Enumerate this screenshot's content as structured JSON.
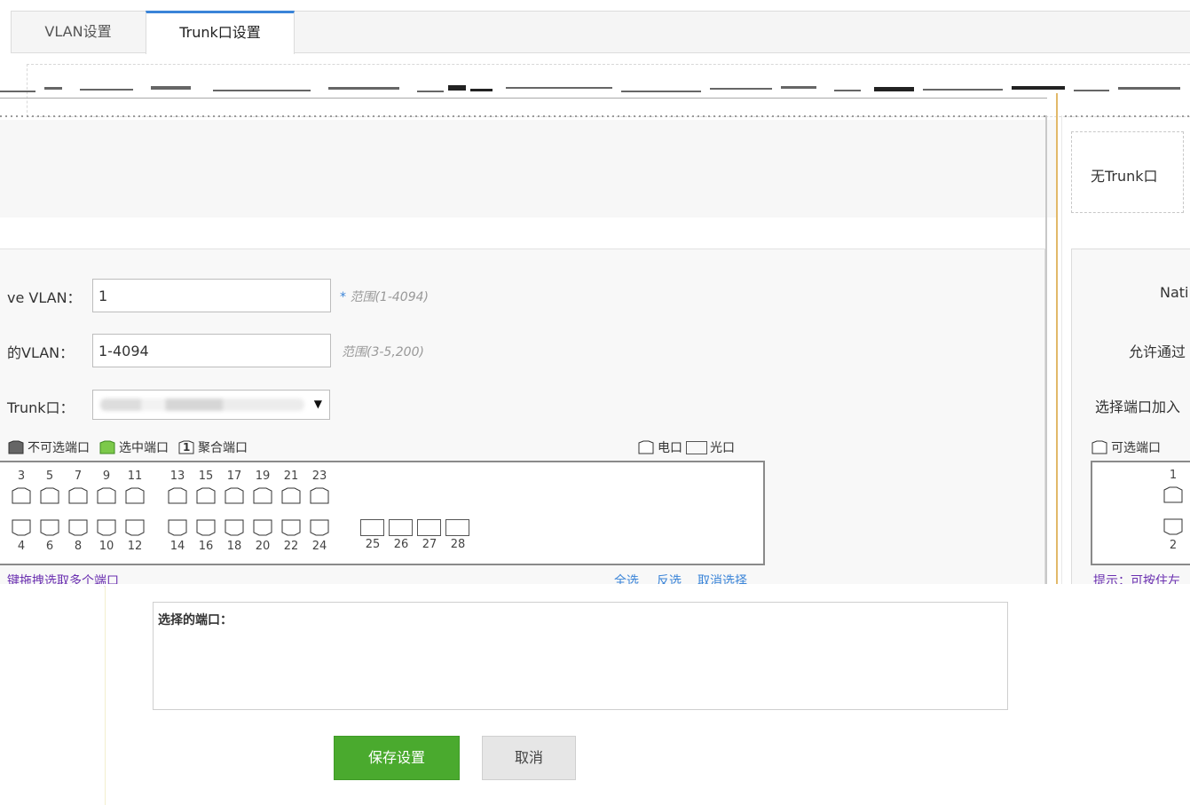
{
  "tabs": [
    {
      "label": "VLAN设置",
      "active": false
    },
    {
      "label": "Trunk口设置",
      "active": true
    }
  ],
  "right_panel": {
    "no_trunk": "无Trunk口",
    "native_label": "Nati",
    "allow_label": "允许通过",
    "select_label": "选择端口加入",
    "legend_selectable": "可选端口",
    "port_num_top": "1",
    "port_num_bottom": "2",
    "hint_link": "提示：可按住左"
  },
  "form": {
    "native_vlan_label": "ve VLAN：",
    "native_vlan_value": "1",
    "native_vlan_hint": "范围(1-4094)",
    "native_vlan_required": "*",
    "allowed_vlan_label": "的VLAN：",
    "allowed_vlan_value": "1-4094",
    "allowed_vlan_hint": "范围(3-5,200)",
    "trunk_label": "Trunk口：",
    "trunk_select_arrow": "▼"
  },
  "legend": {
    "unselectable": "不可选端口",
    "selected": "选中端口",
    "aggregate": "聚合端口",
    "aggregate_num": "1",
    "electric": "电口",
    "optical": "光口"
  },
  "ports": {
    "top_numbers": [
      "3",
      "5",
      "7",
      "9",
      "11",
      "13",
      "15",
      "17",
      "19",
      "21",
      "23"
    ],
    "bottom_numbers": [
      "4",
      "6",
      "8",
      "10",
      "12",
      "14",
      "16",
      "18",
      "20",
      "22",
      "24"
    ],
    "fiber_numbers": [
      "25",
      "26",
      "27",
      "28"
    ]
  },
  "links": {
    "drag_hint": "键拖拽选取多个端口",
    "select_all": "全选",
    "invert": "反选",
    "cancel_select": "取消选择"
  },
  "selected_ports": {
    "title": "选择的端口："
  },
  "buttons": {
    "save": "保存设置",
    "cancel": "取消"
  },
  "colors": {
    "accent_blue": "#3a84d8",
    "save_green": "#4aaa2e",
    "link_purple": "#6a2fb0"
  }
}
